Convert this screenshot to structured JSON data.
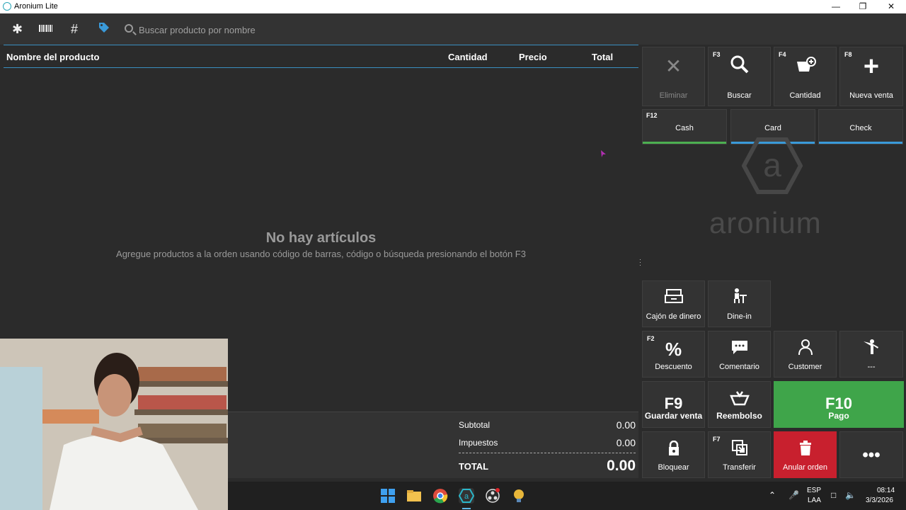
{
  "window": {
    "title": "Aronium Lite"
  },
  "toolbar": {
    "search_placeholder": "Buscar producto por nombre"
  },
  "table": {
    "columns": [
      "Nombre del producto",
      "Cantidad",
      "Precio",
      "Total"
    ],
    "empty_title": "No hay artículos",
    "empty_message": "Agregue productos a la orden usando código de barras, código o búsqueda presionando el botón F3"
  },
  "totals": {
    "subtotal_label": "Subtotal",
    "subtotal_value": "0.00",
    "tax_label": "Impuestos",
    "tax_value": "0.00",
    "total_label": "TOTAL",
    "total_value": "0.00"
  },
  "actions": {
    "delete": {
      "label": "Eliminar"
    },
    "search": {
      "key": "F3",
      "label": "Buscar"
    },
    "quantity": {
      "key": "F4",
      "label": "Cantidad"
    },
    "new_sale": {
      "key": "F8",
      "label": "Nueva venta"
    }
  },
  "payments": {
    "cash": {
      "key": "F12",
      "label": "Cash",
      "color": "#4caf50"
    },
    "card": {
      "label": "Card",
      "color": "#3a9ad9"
    },
    "check": {
      "label": "Check",
      "color": "#3a9ad9"
    }
  },
  "logo": {
    "text": "aronium"
  },
  "functions": {
    "cash_drawer": {
      "label": "Cajón de dinero"
    },
    "dine_in": {
      "label": "Dine-in"
    },
    "discount": {
      "key": "F2",
      "label": "Descuento"
    },
    "comment": {
      "label": "Comentario"
    },
    "customer": {
      "label": "Customer"
    },
    "dash": {
      "label": "---"
    },
    "save_sale": {
      "key_big": "F9",
      "label": "Guardar venta"
    },
    "refund": {
      "label": "Reembolso"
    },
    "pay": {
      "key_big": "F10",
      "label": "Pago",
      "color": "#3fa54a"
    },
    "lock": {
      "label": "Bloquear"
    },
    "transfer": {
      "key": "F7",
      "label": "Transferir"
    },
    "void_order": {
      "label": "Anular orden",
      "color": "#c8202e"
    },
    "more": {
      "label": "•••"
    }
  },
  "taskbar": {
    "lang_top": "ESP",
    "lang_bottom": "LAA",
    "time": "08:14",
    "date": "3/3/2026"
  }
}
